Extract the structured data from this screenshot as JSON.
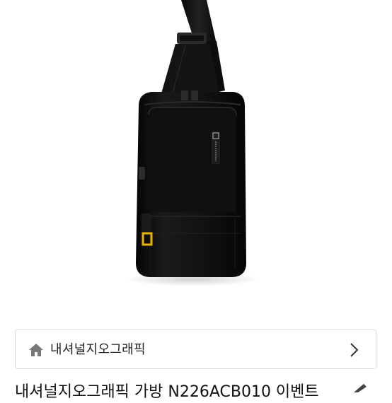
{
  "product_image": {
    "icon": "sling-bag-photo",
    "logo_text": "NATIONAL GEOGRAPHIC",
    "accent_color": "#e8b400",
    "bag_color": "#0e0e0f"
  },
  "shop_link": {
    "icon": "home-icon",
    "shop_name": "내셔널지오그래픽",
    "chevron": "chevron-right-icon"
  },
  "product_title_partial": "내셔널지오그래픽 가방 N226ACB010 이벤트",
  "title_action_icon": "edit-icon"
}
